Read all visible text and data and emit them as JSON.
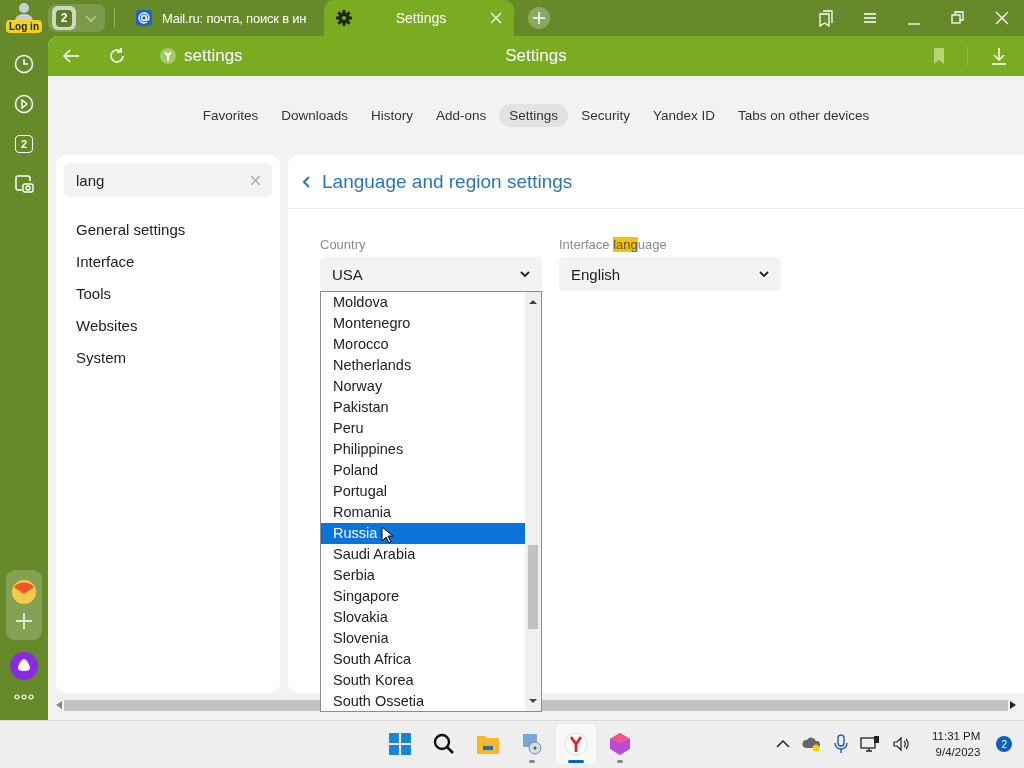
{
  "tab_strip": {
    "login_label": "Log in",
    "tab_count": "2",
    "tabs": [
      {
        "title": "Mail.ru: почта, поиск в ин",
        "selected": false,
        "kind": "mail"
      },
      {
        "title": "Settings",
        "selected": true,
        "kind": "settings"
      }
    ]
  },
  "address_bar": {
    "url": "settings",
    "page_title": "Settings"
  },
  "sidebar": {
    "tab_count": "2"
  },
  "nav_tabs": [
    {
      "label": "Favorites",
      "selected": false
    },
    {
      "label": "Downloads",
      "selected": false
    },
    {
      "label": "History",
      "selected": false
    },
    {
      "label": "Add-ons",
      "selected": false
    },
    {
      "label": "Settings",
      "selected": true
    },
    {
      "label": "Security",
      "selected": false
    },
    {
      "label": "Yandex ID",
      "selected": false
    },
    {
      "label": "Tabs on other devices",
      "selected": false
    }
  ],
  "search": {
    "value": "lang"
  },
  "settings_menu": [
    "General settings",
    "Interface",
    "Tools",
    "Websites",
    "System"
  ],
  "section": {
    "title": "Language and region settings"
  },
  "country": {
    "label": "Country",
    "value": "USA"
  },
  "interface_language": {
    "label_before": "Interface ",
    "label_match": "lang",
    "label_after": "uage",
    "value": "English"
  },
  "country_list": [
    {
      "name": "Moldova",
      "selected": false
    },
    {
      "name": "Montenegro",
      "selected": false
    },
    {
      "name": "Morocco",
      "selected": false
    },
    {
      "name": "Netherlands",
      "selected": false
    },
    {
      "name": "Norway",
      "selected": false
    },
    {
      "name": "Pakistan",
      "selected": false
    },
    {
      "name": "Peru",
      "selected": false
    },
    {
      "name": "Philippines",
      "selected": false
    },
    {
      "name": "Poland",
      "selected": false
    },
    {
      "name": "Portugal",
      "selected": false
    },
    {
      "name": "Romania",
      "selected": false
    },
    {
      "name": "Russia",
      "selected": true
    },
    {
      "name": "Saudi Arabia",
      "selected": false
    },
    {
      "name": "Serbia",
      "selected": false
    },
    {
      "name": "Singapore",
      "selected": false
    },
    {
      "name": "Slovakia",
      "selected": false
    },
    {
      "name": "Slovenia",
      "selected": false
    },
    {
      "name": "South Africa",
      "selected": false
    },
    {
      "name": "South Korea",
      "selected": false
    },
    {
      "name": "South Ossetia",
      "selected": false
    }
  ],
  "taskbar": {
    "apps": [
      {
        "kind": "start",
        "running": false,
        "active": false
      },
      {
        "kind": "search",
        "running": false,
        "active": false
      },
      {
        "kind": "folder",
        "running": false,
        "active": false
      },
      {
        "kind": "computer",
        "running": true,
        "active": false
      },
      {
        "kind": "browser",
        "running": true,
        "active": true
      },
      {
        "kind": "gem",
        "running": true,
        "active": false
      }
    ],
    "time": "11:31 PM",
    "date": "9/4/2023",
    "notification_count": "2"
  }
}
